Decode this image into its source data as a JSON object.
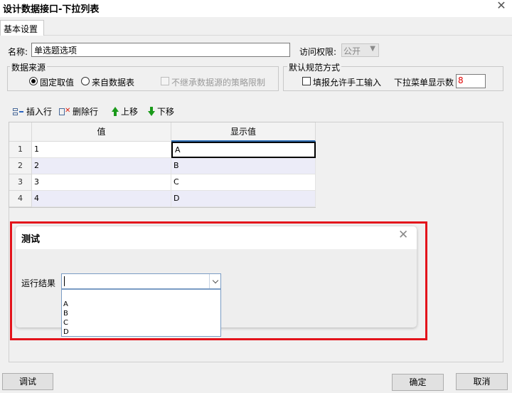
{
  "window": {
    "title": "设计数据接口-下拉列表",
    "close": "✕"
  },
  "tabs": [
    {
      "label": "基本设置"
    }
  ],
  "form": {
    "name_label": "名称:",
    "name_value": "单选题选项",
    "access_label": "访问权限:",
    "access_value": "公开",
    "data_source": {
      "title": "数据来源",
      "option_fixed": "固定取值",
      "option_db": "来自数据表",
      "inherit_label": "不继承数据源的策略限制",
      "selected": "固定取值"
    },
    "default_mode": {
      "title": "默认规范方式",
      "manual_input_label": "填报允许手工输入",
      "dropdown_count_label": "下拉菜单显示数",
      "dropdown_count_value": "8"
    }
  },
  "toolbar": {
    "insert_row": "插入行",
    "delete_row": "删除行",
    "move_up": "上移",
    "move_down": "下移"
  },
  "table": {
    "headers": [
      "值",
      "显示值"
    ],
    "rows": [
      {
        "num": "1",
        "value": "1",
        "display": "A"
      },
      {
        "num": "2",
        "value": "2",
        "display": "B"
      },
      {
        "num": "3",
        "value": "3",
        "display": "C"
      },
      {
        "num": "4",
        "value": "4",
        "display": "D"
      }
    ]
  },
  "test_dialog": {
    "title": "测试",
    "close": "✕",
    "result_label": "运行结果",
    "options": [
      "A",
      "B",
      "C",
      "D"
    ]
  },
  "buttons": {
    "debug": "调试",
    "confirm": "确定",
    "cancel": "取消"
  },
  "colors": {
    "annotation_red": "#e3131b",
    "count_red": "#e00000",
    "arrow_green": "#1a9a1a"
  }
}
